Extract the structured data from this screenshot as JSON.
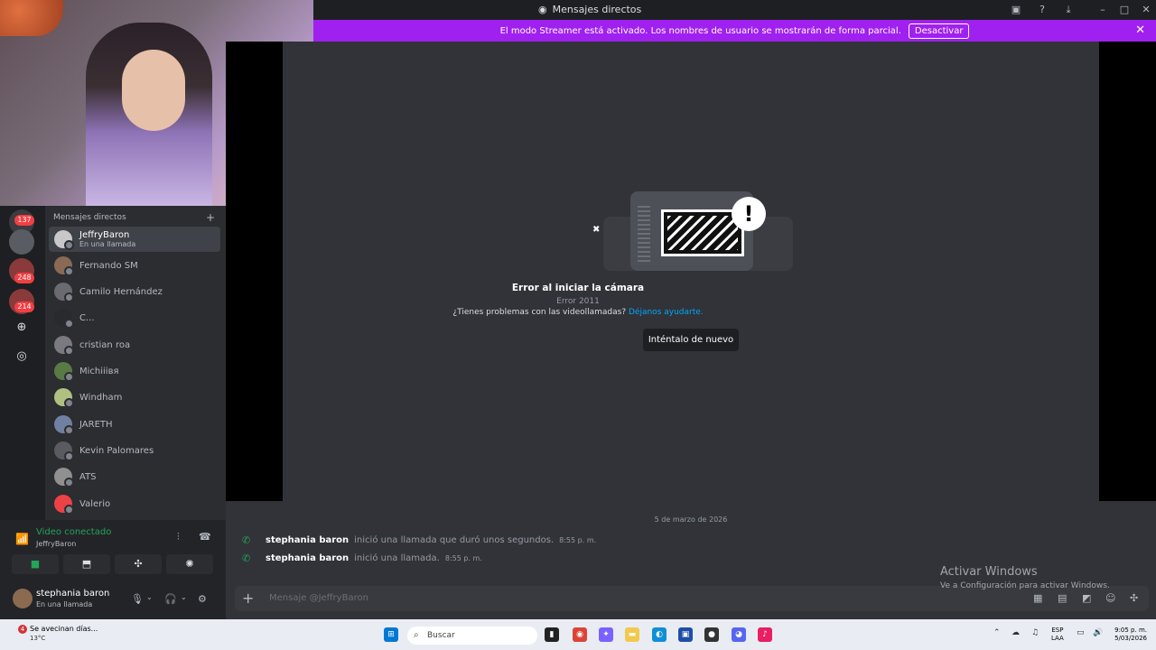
{
  "window": {
    "title": "Mensajes directos"
  },
  "banner": {
    "text": "El modo Streamer está activado. Los nombres de usuario se mostrarán de forma parcial.",
    "button": "Desactivar"
  },
  "servers": {
    "badges": [
      "137",
      "248",
      "214"
    ]
  },
  "dm_list": {
    "header": "Mensajes directos",
    "items": [
      {
        "name": "JeffryBaron",
        "status": "En una llamada"
      },
      {
        "name": "Fernando SM"
      },
      {
        "name": "Camilo Hernández"
      },
      {
        "name": "C..."
      },
      {
        "name": "cristian roa"
      },
      {
        "name": "Michiiiвя"
      },
      {
        "name": "Windham"
      },
      {
        "name": "JARETH"
      },
      {
        "name": "Kevin Palomares"
      },
      {
        "name": "ATS"
      },
      {
        "name": "Valerio"
      }
    ]
  },
  "voice": {
    "status": "Video conectado",
    "channel": "JeffryBaron"
  },
  "user": {
    "name": "stephania baron",
    "status": "En una llamada"
  },
  "call": {
    "error_title": "Error al iniciar la cámara",
    "error_code": "Error 2011",
    "help_text": "¿Tienes problemas con las videollamadas?",
    "help_link": "Déjanos ayudarte.",
    "retry_button": "Inténtalo de nuevo"
  },
  "chat": {
    "date_divider": "5 de marzo de 2026",
    "messages": [
      {
        "author": "stephania baron",
        "text": "inició una llamada que duró unos segundos.",
        "time": "8:55 p. m."
      },
      {
        "author": "stephania baron",
        "text": "inició una llamada.",
        "time": "8:55 p. m."
      }
    ],
    "placeholder": "Mensaje @JeffryBaron"
  },
  "watermark": {
    "line1": "Activar Windows",
    "line2": "Ve a Configuración para activar Windows."
  },
  "taskbar": {
    "weather_text": "Se avecinan días...",
    "weather_temp": "13°C",
    "weather_badge": "4",
    "search_label": "Buscar",
    "lang_1": "ESP",
    "lang_2": "LAA",
    "time": "9:05 p. m.",
    "date": "5/03/2026"
  }
}
